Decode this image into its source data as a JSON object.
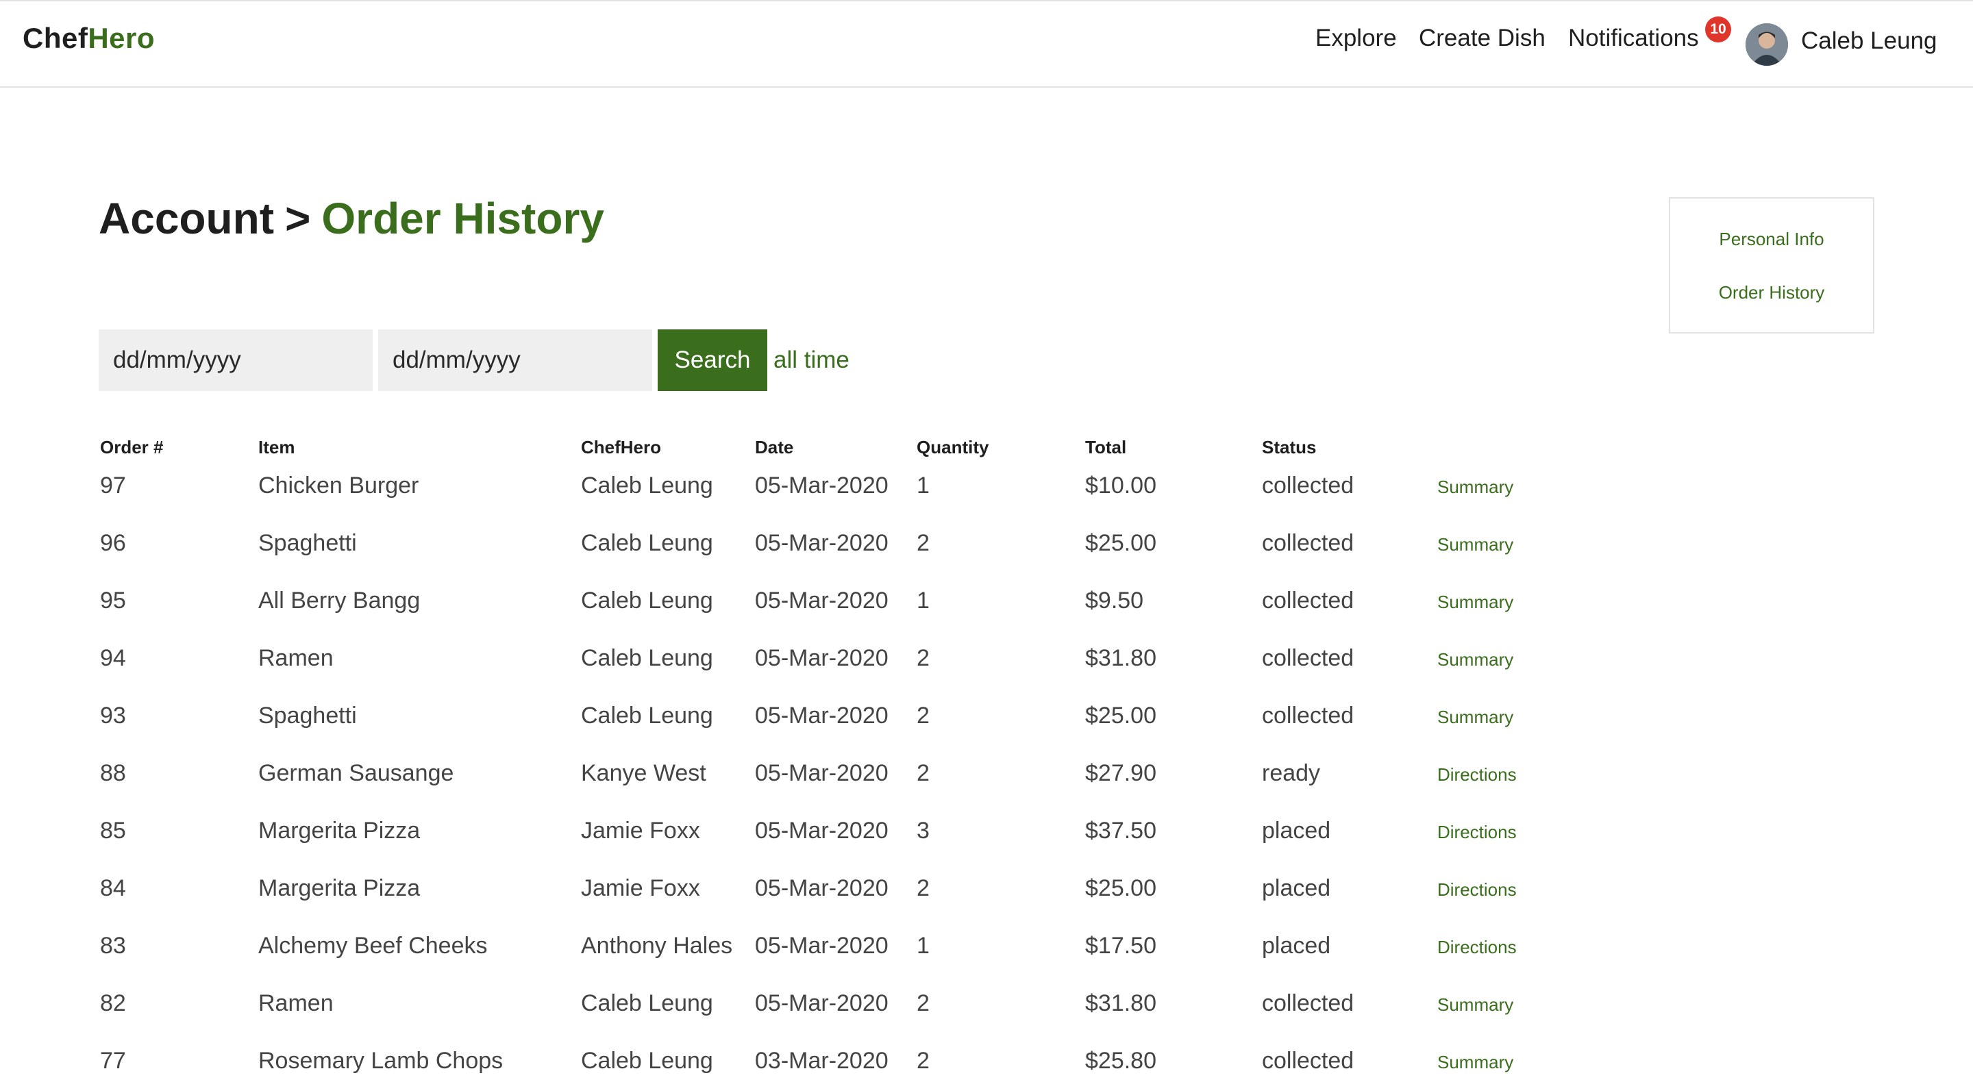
{
  "header": {
    "brand_part1": "Chef",
    "brand_part2": "Hero",
    "nav": [
      "Explore",
      "Create Dish",
      "Notifications"
    ],
    "notification_count": "10",
    "user_name": "Caleb Leung"
  },
  "title": {
    "parent": "Account",
    "separator": ">",
    "current": "Order History"
  },
  "side_menu": [
    "Personal Info",
    "Order History"
  ],
  "filter": {
    "from_placeholder": "dd/mm/yyyy",
    "to_placeholder": "dd/mm/yyyy",
    "search_label": "Search",
    "all_time_label": "all time"
  },
  "table": {
    "columns": [
      "Order #",
      "Item",
      "ChefHero",
      "Date",
      "Quantity",
      "Total",
      "Status"
    ],
    "rows": [
      {
        "order": "97",
        "item": "Chicken Burger",
        "chef": "Caleb Leung",
        "date": "05-Mar-2020",
        "qty": "1",
        "total": "$10.00",
        "status": "collected",
        "action": "Summary"
      },
      {
        "order": "96",
        "item": "Spaghetti",
        "chef": "Caleb Leung",
        "date": "05-Mar-2020",
        "qty": "2",
        "total": "$25.00",
        "status": "collected",
        "action": "Summary"
      },
      {
        "order": "95",
        "item": "All Berry Bangg",
        "chef": "Caleb Leung",
        "date": "05-Mar-2020",
        "qty": "1",
        "total": "$9.50",
        "status": "collected",
        "action": "Summary"
      },
      {
        "order": "94",
        "item": "Ramen",
        "chef": "Caleb Leung",
        "date": "05-Mar-2020",
        "qty": "2",
        "total": "$31.80",
        "status": "collected",
        "action": "Summary"
      },
      {
        "order": "93",
        "item": "Spaghetti",
        "chef": "Caleb Leung",
        "date": "05-Mar-2020",
        "qty": "2",
        "total": "$25.00",
        "status": "collected",
        "action": "Summary"
      },
      {
        "order": "88",
        "item": "German Sausange",
        "chef": "Kanye West",
        "date": "05-Mar-2020",
        "qty": "2",
        "total": "$27.90",
        "status": "ready",
        "action": "Directions"
      },
      {
        "order": "85",
        "item": "Margerita Pizza",
        "chef": "Jamie Foxx",
        "date": "05-Mar-2020",
        "qty": "3",
        "total": "$37.50",
        "status": "placed",
        "action": "Directions"
      },
      {
        "order": "84",
        "item": "Margerita Pizza",
        "chef": "Jamie Foxx",
        "date": "05-Mar-2020",
        "qty": "2",
        "total": "$25.00",
        "status": "placed",
        "action": "Directions"
      },
      {
        "order": "83",
        "item": "Alchemy Beef Cheeks",
        "chef": "Anthony Hales",
        "date": "05-Mar-2020",
        "qty": "1",
        "total": "$17.50",
        "status": "placed",
        "action": "Directions"
      },
      {
        "order": "82",
        "item": "Ramen",
        "chef": "Caleb Leung",
        "date": "05-Mar-2020",
        "qty": "2",
        "total": "$31.80",
        "status": "collected",
        "action": "Summary"
      },
      {
        "order": "77",
        "item": "Rosemary Lamb Chops",
        "chef": "Caleb Leung",
        "date": "03-Mar-2020",
        "qty": "2",
        "total": "$25.80",
        "status": "collected",
        "action": "Summary"
      }
    ]
  },
  "colors": {
    "brand_green": "#3a6e1d",
    "badge_red": "#e0352b",
    "input_bg": "#efefef"
  },
  "icons": {
    "avatar": "user-avatar-photo"
  }
}
